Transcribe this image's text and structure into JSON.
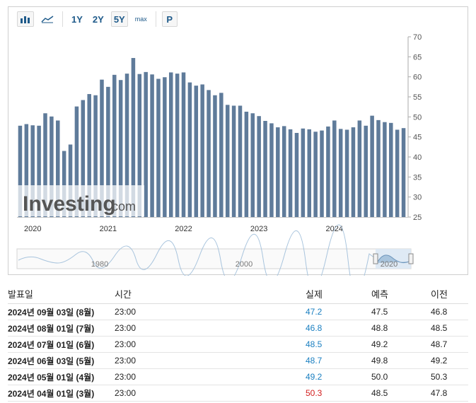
{
  "toolbar": {
    "icons": [
      "bar-chart-icon",
      "area-chart-icon"
    ],
    "ranges": [
      "1Y",
      "2Y",
      "5Y",
      "max"
    ],
    "active_range": "5Y",
    "extra": "P"
  },
  "watermark": {
    "text": "Investing",
    "suffix": ".com"
  },
  "chart_data": {
    "type": "bar",
    "values": [
      47.8,
      48.2,
      47.9,
      47.8,
      50.9,
      50.1,
      49.1,
      41.5,
      43.1,
      52.6,
      54.2,
      55.7,
      55.4,
      59.3,
      57.5,
      60.5,
      59.2,
      60.8,
      64.7,
      60.7,
      61.2,
      60.6,
      59.5,
      59.9,
      61.1,
      60.8,
      61.1,
      58.6,
      57.8,
      58.1,
      56.7,
      55.4,
      56.0,
      53.0,
      52.8,
      52.8,
      51.3,
      50.9,
      50.2,
      49.0,
      48.4,
      47.4,
      47.7,
      46.9,
      46.0,
      47.1,
      46.9,
      46.3,
      46.6,
      47.6,
      49.1,
      47.0,
      46.8,
      47.4,
      49.1,
      47.8,
      50.3,
      49.2,
      48.7,
      48.5,
      46.8,
      47.2
    ],
    "x_tick_labels": [
      "2020",
      "2021",
      "2022",
      "2023",
      "2024"
    ],
    "ylim": [
      25,
      70
    ],
    "y_ticks": [
      25,
      30,
      35,
      40,
      45,
      50,
      55,
      60,
      65,
      70
    ],
    "y_axis_side": "right",
    "color": "#5f7b9a",
    "navigator_labels": [
      "1980",
      "2000",
      "2020"
    ]
  },
  "table": {
    "headers": {
      "date": "발표일",
      "time": "시간",
      "actual": "실제",
      "forecast": "예측",
      "previous": "이전"
    },
    "rows": [
      {
        "date": "2024년 09월 03일 (8월)",
        "time": "23:00",
        "actual": "47.2",
        "actual_color": "blue",
        "forecast": "47.5",
        "previous": "46.8"
      },
      {
        "date": "2024년 08월 01일 (7월)",
        "time": "23:00",
        "actual": "46.8",
        "actual_color": "blue",
        "forecast": "48.8",
        "previous": "48.5"
      },
      {
        "date": "2024년 07월 01일 (6월)",
        "time": "23:00",
        "actual": "48.5",
        "actual_color": "blue",
        "forecast": "49.2",
        "previous": "48.7"
      },
      {
        "date": "2024년 06월 03일 (5월)",
        "time": "23:00",
        "actual": "48.7",
        "actual_color": "blue",
        "forecast": "49.8",
        "previous": "49.2"
      },
      {
        "date": "2024년 05월 01일 (4월)",
        "time": "23:00",
        "actual": "49.2",
        "actual_color": "blue",
        "forecast": "50.0",
        "previous": "50.3"
      },
      {
        "date": "2024년 04월 01일 (3월)",
        "time": "23:00",
        "actual": "50.3",
        "actual_color": "red",
        "forecast": "48.5",
        "previous": "47.8"
      }
    ]
  }
}
